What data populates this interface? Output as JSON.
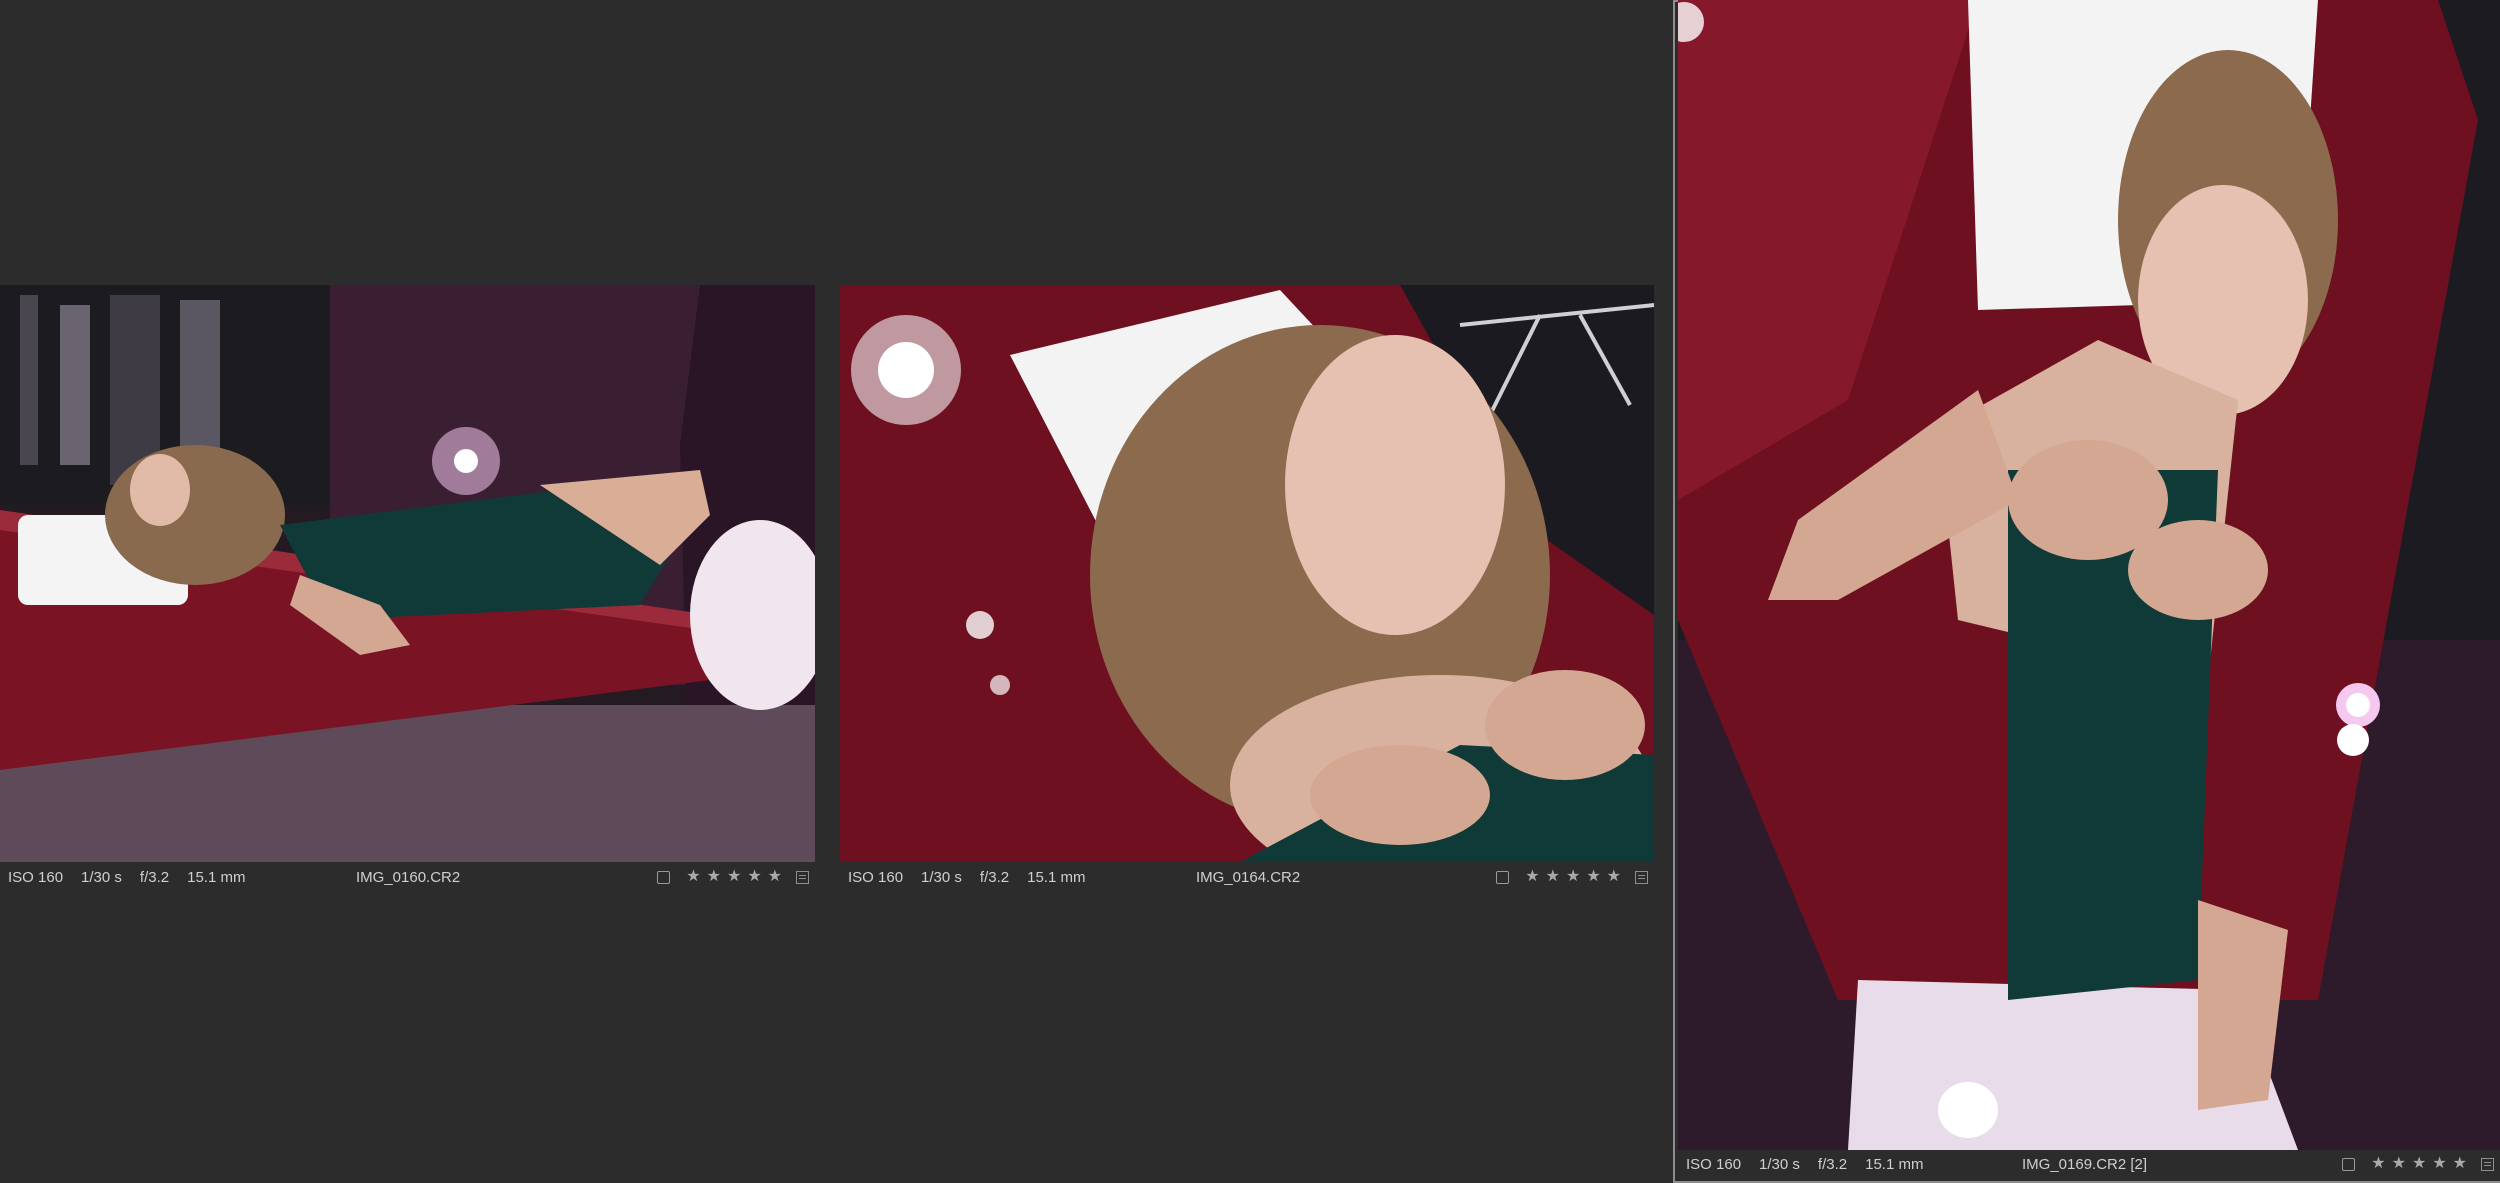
{
  "viewers": [
    {
      "iso": "ISO 160",
      "shutter": "1/30 s",
      "aperture": "f/3.2",
      "focal": "15.1 mm",
      "filename": "IMG_0160.CR2",
      "stars": [
        "★",
        "★",
        "★",
        "★",
        "★"
      ],
      "photo_icon": "photo-thumbnail-woman-lying-on-red-table"
    },
    {
      "iso": "ISO 160",
      "shutter": "1/30 s",
      "aperture": "f/3.2",
      "focal": "15.1 mm",
      "filename": "IMG_0164.CR2",
      "stars": [
        "★",
        "★",
        "★",
        "★",
        "★"
      ],
      "photo_icon": "photo-close-up-portrait"
    },
    {
      "iso": "ISO 160",
      "shutter": "1/30 s",
      "aperture": "f/3.2",
      "focal": "15.1 mm",
      "filename": "IMG_0169.CR2 [2]",
      "stars": [
        "★",
        "★",
        "★",
        "★",
        "★"
      ],
      "photo_icon": "photo-overhead-portrait",
      "selected": true
    }
  ],
  "colors": {
    "background": "#2c2c2c",
    "table_red": "#7a1424",
    "dress_green": "#0f3a37",
    "backdrop": "#3a1f33",
    "light_pink": "#f5c9ef"
  }
}
